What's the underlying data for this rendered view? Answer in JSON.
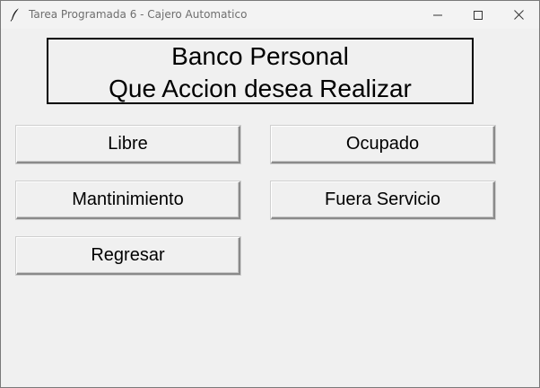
{
  "window": {
    "title": "Tarea Programada 6 - Cajero Automatico",
    "icons": {
      "app": "feather-icon",
      "minimize": "minimize-icon",
      "maximize": "maximize-icon",
      "close": "close-icon"
    }
  },
  "header": {
    "line1": "Banco Personal",
    "line2": "Que Accion desea Realizar"
  },
  "buttons": {
    "libre": "Libre",
    "ocupado": "Ocupado",
    "mantenimiento": "Mantinimiento",
    "fuera_servicio": "Fuera Servicio",
    "regresar": "Regresar"
  },
  "colors": {
    "background": "#f0f0f0",
    "titlebar": "#f3f3f3",
    "text": "#000000",
    "title_text": "#6e6e6e"
  }
}
